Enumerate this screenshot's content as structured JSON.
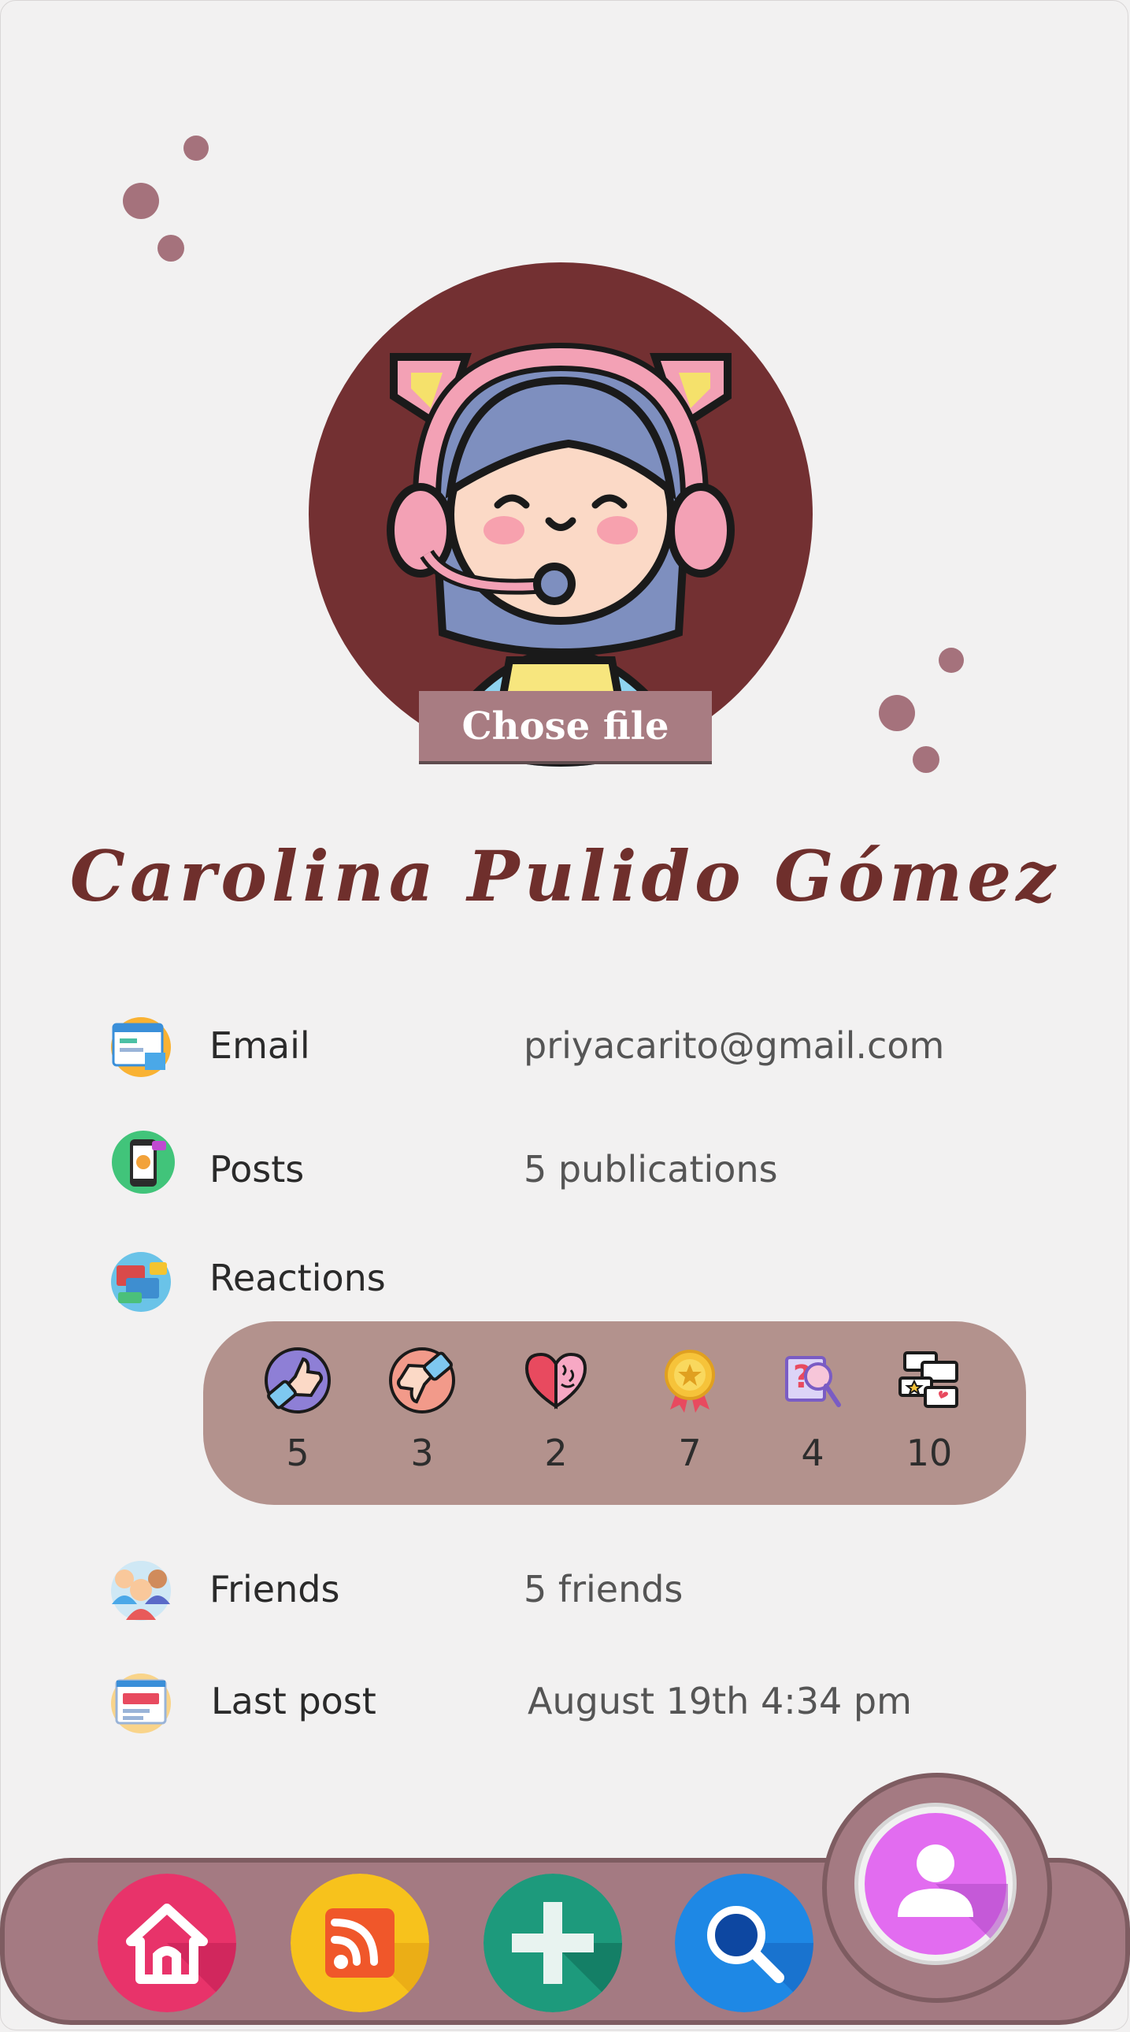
{
  "profile": {
    "choose_file_label": "Chose file",
    "full_name": "Carolina Pulido Gómez"
  },
  "info": {
    "email": {
      "label": "Email",
      "value": "priyacarito@gmail.com"
    },
    "posts": {
      "label": "Posts",
      "value": "5 publications"
    },
    "reactions": {
      "label": "Reactions"
    },
    "friends": {
      "label": "Friends",
      "value": "5 friends"
    },
    "last_post": {
      "label": "Last post",
      "value": "August 19th 4:34 pm"
    }
  },
  "reactions": [
    {
      "icon": "thumbs-up-icon",
      "count": "5"
    },
    {
      "icon": "thumbs-down-icon",
      "count": "3"
    },
    {
      "icon": "heart-brain-icon",
      "count": "2"
    },
    {
      "icon": "medal-icon",
      "count": "7"
    },
    {
      "icon": "question-search-icon",
      "count": "4"
    },
    {
      "icon": "comments-icon",
      "count": "10"
    }
  ],
  "nav": [
    {
      "icon": "home-icon"
    },
    {
      "icon": "rss-feed-icon"
    },
    {
      "icon": "add-icon"
    },
    {
      "icon": "search-icon"
    },
    {
      "icon": "profile-icon"
    }
  ],
  "colors": {
    "background": "#f2f1f1",
    "avatar_circle": "#733032",
    "accent_mauve": "#a87c82",
    "name_text": "#6f2f2c",
    "reactions_box": "#b3928d"
  }
}
